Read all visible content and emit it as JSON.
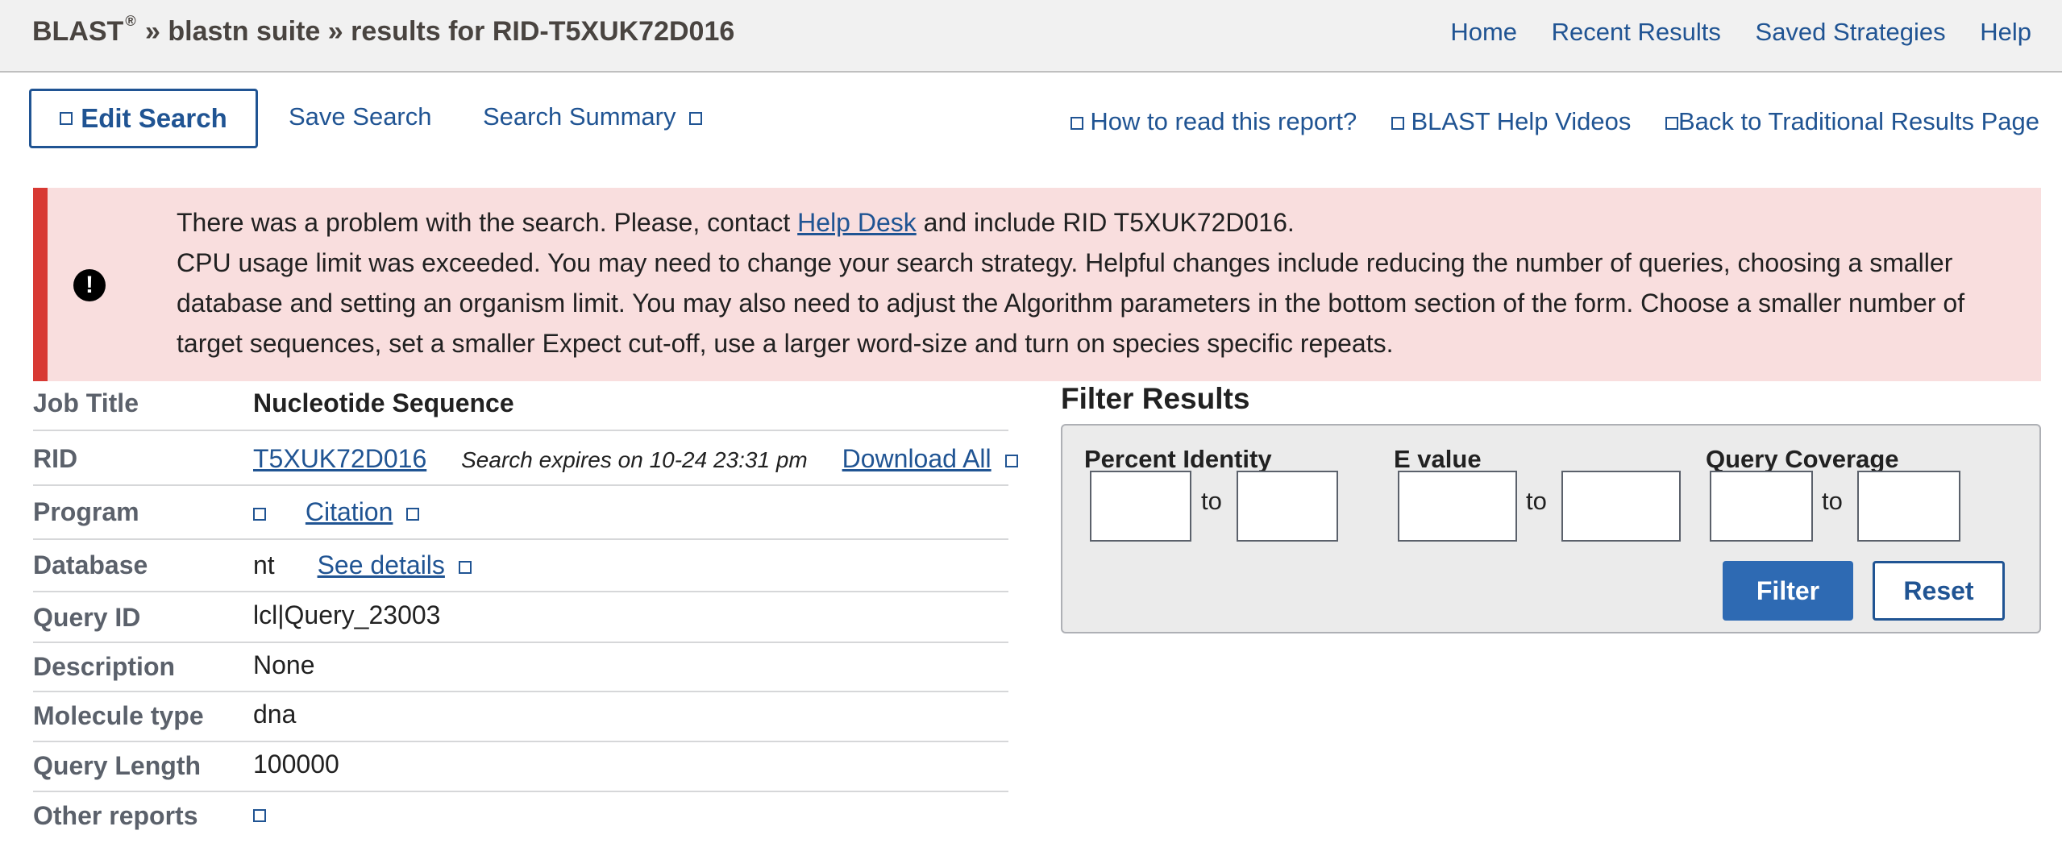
{
  "header": {
    "brand": "BLAST",
    "registered": "®",
    "crumb_suite": "» blastn suite",
    "crumb_results": "» results for RID-T5XUK72D016",
    "nav": [
      "Home",
      "Recent Results",
      "Saved Strategies",
      "Help"
    ]
  },
  "toolbar": {
    "edit_search": "Edit Search",
    "save_search": "Save Search",
    "search_summary": "Search Summary",
    "how_to_read": "How to read this report?",
    "help_videos": "BLAST Help Videos",
    "back_traditional": "Back to Traditional Results Page"
  },
  "alert": {
    "icon": "exclamation-circle-icon",
    "line1_pre": "There was a problem with the search. Please, contact ",
    "line1_link": "Help Desk",
    "line1_post": " and include RID T5XUK72D016.",
    "message": "CPU usage limit was exceeded. You may need to change your search strategy. Helpful changes include reducing the number of queries, choosing a smaller database and setting an organism limit. You may also need to adjust the Algorithm parameters in the bottom section of the form. Choose a smaller number of target sequences, set a smaller Expect cut-off, use a larger word-size and turn on species specific repeats.",
    "color": "#d83933"
  },
  "info": {
    "job_title_label": "Job Title",
    "job_title": "Nucleotide Sequence",
    "rid_label": "RID",
    "rid": "T5XUK72D016",
    "expires": "Search expires on 10-24 23:31 pm",
    "download_all": "Download All",
    "program_label": "Program",
    "citation": "Citation",
    "database_label": "Database",
    "database": "nt",
    "see_details": "See details",
    "query_id_label": "Query ID",
    "query_id": "lcl|Query_23003",
    "description_label": "Description",
    "description": "None",
    "molecule_type_label": "Molecule type",
    "molecule_type": "dna",
    "query_length_label": "Query Length",
    "query_length": "100000",
    "other_reports_label": "Other reports"
  },
  "filter": {
    "title": "Filter Results",
    "percent_identity": "Percent Identity",
    "e_value": "E value",
    "query_coverage": "Query Coverage",
    "to": "to",
    "filter_button": "Filter",
    "reset_button": "Reset",
    "inputs": {
      "pi_from": "",
      "pi_to": "",
      "ev_from": "",
      "ev_to": "",
      "qc_from": "",
      "qc_to": ""
    }
  }
}
